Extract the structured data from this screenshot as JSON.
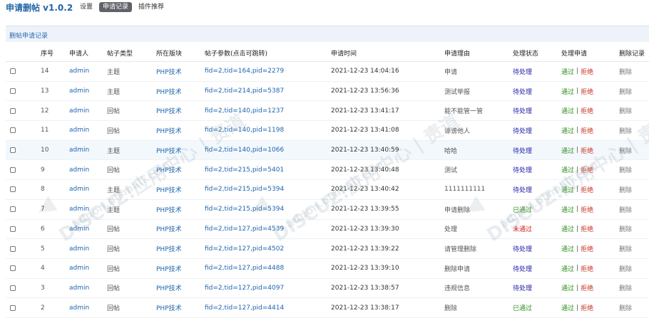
{
  "app": {
    "title": "申请删帖 v1.0.2"
  },
  "nav": [
    {
      "label": "设置",
      "active": false
    },
    {
      "label": "申请记录",
      "active": true
    },
    {
      "label": "插件推荐",
      "active": false
    }
  ],
  "panel": {
    "title": "删帖申请记录"
  },
  "columns": {
    "no": "序号",
    "user": "申请人",
    "type": "帖子类型",
    "forum": "所在版块",
    "param": "帖子参数(点击可跳转)",
    "time": "申请时间",
    "reason": "申请理由",
    "status": "处理状态",
    "action": "处理申请",
    "del": "删除记录"
  },
  "actions": {
    "pass": "通过",
    "sep": "|",
    "reject": "拒绝",
    "delete": "删除"
  },
  "rows": [
    {
      "no": "14",
      "user": "admin",
      "type": "主题",
      "forum": "PHP技术",
      "param": "fid=2,tid=164,pid=2279",
      "time": "2021-12-23 14:04:16",
      "reason": "申请",
      "status": "待处理",
      "status_kind": "pending"
    },
    {
      "no": "13",
      "user": "admin",
      "type": "主题",
      "forum": "PHP技术",
      "param": "fid=2,tid=214,pid=5387",
      "time": "2021-12-23 13:56:36",
      "reason": "测试举报",
      "status": "待处理",
      "status_kind": "pending"
    },
    {
      "no": "12",
      "user": "admin",
      "type": "回帖",
      "forum": "PHP技术",
      "param": "fid=2,tid=140,pid=1237",
      "time": "2021-12-23 13:41:17",
      "reason": "能不能管一管",
      "status": "待处理",
      "status_kind": "pending"
    },
    {
      "no": "11",
      "user": "admin",
      "type": "回帖",
      "forum": "PHP技术",
      "param": "fid=2,tid=140,pid=1198",
      "time": "2021-12-23 13:41:08",
      "reason": "诽谤他人",
      "status": "待处理",
      "status_kind": "pending"
    },
    {
      "no": "10",
      "user": "admin",
      "type": "主题",
      "forum": "PHP技术",
      "param": "fid=2,tid=140,pid=1066",
      "time": "2021-12-23 13:40:59",
      "reason": "哈哈",
      "status": "待处理",
      "status_kind": "pending"
    },
    {
      "no": "9",
      "user": "admin",
      "type": "回帖",
      "forum": "PHP技术",
      "param": "fid=2,tid=215,pid=5401",
      "time": "2021-12-23 13:40:48",
      "reason": "测试",
      "status": "待处理",
      "status_kind": "pending"
    },
    {
      "no": "8",
      "user": "admin",
      "type": "主题",
      "forum": "PHP技术",
      "param": "fid=2,tid=215,pid=5394",
      "time": "2021-12-23 13:40:42",
      "reason": "1111111111",
      "status": "待处理",
      "status_kind": "pending"
    },
    {
      "no": "7",
      "user": "admin",
      "type": "主题",
      "forum": "PHP技术",
      "param": "fid=2,tid=215,pid=5394",
      "time": "2021-12-23 13:39:55",
      "reason": "申请删除",
      "status": "已通过",
      "status_kind": "passed"
    },
    {
      "no": "6",
      "user": "admin",
      "type": "回帖",
      "forum": "PHP技术",
      "param": "fid=2,tid=127,pid=4539",
      "time": "2021-12-23 13:39:30",
      "reason": "处理",
      "status": "未通过",
      "status_kind": "rejected"
    },
    {
      "no": "5",
      "user": "admin",
      "type": "回帖",
      "forum": "PHP技术",
      "param": "fid=2,tid=127,pid=4502",
      "time": "2021-12-23 13:39:22",
      "reason": "请管理删除",
      "status": "待处理",
      "status_kind": "pending"
    },
    {
      "no": "4",
      "user": "admin",
      "type": "回帖",
      "forum": "PHP技术",
      "param": "fid=2,tid=127,pid=4488",
      "time": "2021-12-23 13:39:10",
      "reason": "删除申请",
      "status": "待处理",
      "status_kind": "pending"
    },
    {
      "no": "3",
      "user": "admin",
      "type": "回帖",
      "forum": "PHP技术",
      "param": "fid=2,tid=127,pid=4097",
      "time": "2021-12-23 13:38:57",
      "reason": "违规信息",
      "status": "待处理",
      "status_kind": "pending"
    },
    {
      "no": "2",
      "user": "admin",
      "type": "回帖",
      "forum": "PHP技术",
      "param": "fid=2,tid=127,pid=4414",
      "time": "2021-12-23 13:38:17",
      "reason": "删除",
      "status": "已通过",
      "status_kind": "passed"
    }
  ],
  "watermark": {
    "line1": "DISCUZ!应用中心 | 责道",
    "line2": "addon.dismall.com"
  }
}
